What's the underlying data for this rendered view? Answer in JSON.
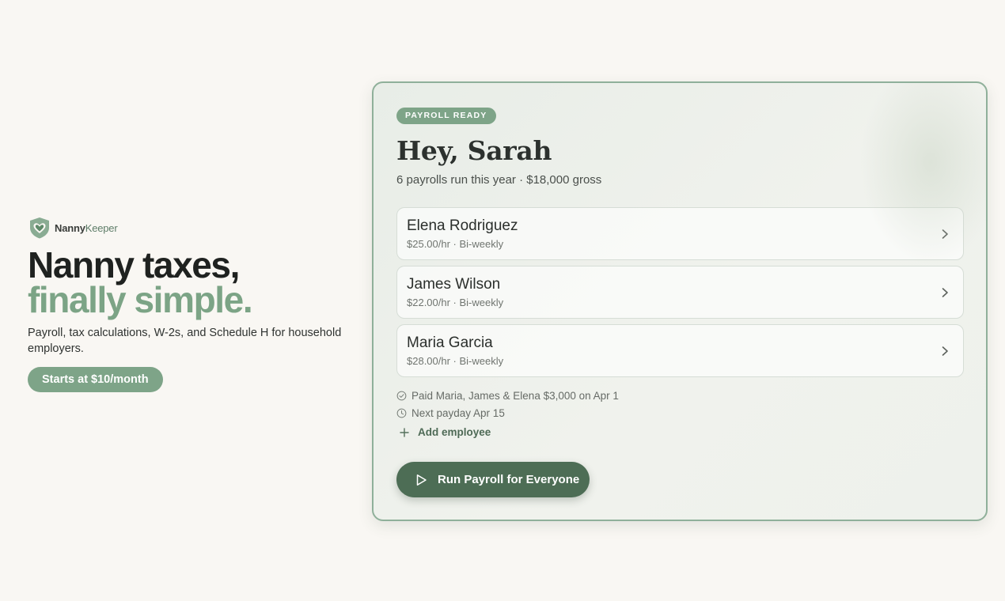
{
  "brand": {
    "name_part1": "Nanny",
    "name_part2": "Keeper"
  },
  "hero": {
    "headline_line1": "Nanny taxes,",
    "headline_line2": "finally simple.",
    "subtext": "Payroll, tax calculations, W-2s, and Schedule H for household employers.",
    "cta_label": "Starts at $10/month"
  },
  "card": {
    "badge": "PAYROLL READY",
    "greeting": "Hey, Sarah",
    "summary": "6 payrolls run this year · $18,000 gross",
    "employees": [
      {
        "name": "Elena Rodriguez",
        "meta": "$25.00/hr · Bi-weekly"
      },
      {
        "name": "James Wilson",
        "meta": "$22.00/hr · Bi-weekly"
      },
      {
        "name": "Maria Garcia",
        "meta": "$28.00/hr · Bi-weekly"
      }
    ],
    "activity": {
      "paid": "Paid Maria, James & Elena $3,000 on Apr 1",
      "next_payday": "Next payday Apr 15"
    },
    "add_employee_label": "Add employee",
    "run_button_label": "Run Payroll for Everyone"
  },
  "colors": {
    "background": "#f9f7f3",
    "accent_green": "#7ea488",
    "dark_green": "#4d6d55",
    "card_border": "#8fb09a"
  },
  "icons": {
    "logo": "heart-shield-icon",
    "chevron": "chevron-right-icon",
    "check": "check-circle-icon",
    "clock": "clock-icon",
    "plus": "plus-icon",
    "play": "play-icon"
  }
}
